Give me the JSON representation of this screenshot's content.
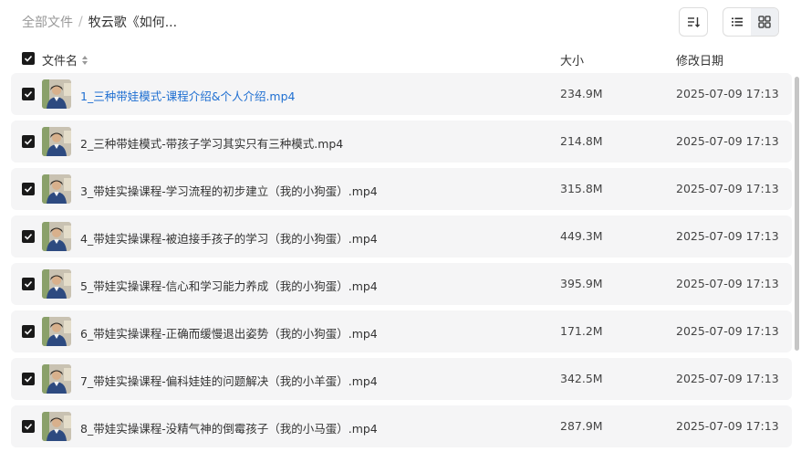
{
  "breadcrumb": {
    "root": "全部文件",
    "separator": "/",
    "current": "牧云歌《如何..."
  },
  "columns": {
    "name": "文件名",
    "size": "大小",
    "modified": "修改日期"
  },
  "files": [
    {
      "name": "1_三种带娃模式-课程介绍&个人介绍.mp4",
      "size": "234.9M",
      "date": "2025-07-09 17:13"
    },
    {
      "name": "2_三种带娃模式-带孩子学习其实只有三种模式.mp4",
      "size": "214.8M",
      "date": "2025-07-09 17:13"
    },
    {
      "name": "3_带娃实操课程-学习流程的初步建立（我的小狗蛋）.mp4",
      "size": "315.8M",
      "date": "2025-07-09 17:13"
    },
    {
      "name": "4_带娃实操课程-被迫接手孩子的学习（我的小狗蛋）.mp4",
      "size": "449.3M",
      "date": "2025-07-09 17:13"
    },
    {
      "name": "5_带娃实操课程-信心和学习能力养成（我的小狗蛋）.mp4",
      "size": "395.9M",
      "date": "2025-07-09 17:13"
    },
    {
      "name": "6_带娃实操课程-正确而缓慢退出姿势（我的小狗蛋）.mp4",
      "size": "171.2M",
      "date": "2025-07-09 17:13"
    },
    {
      "name": "7_带娃实操课程-偏科娃娃的问题解决（我的小羊蛋）.mp4",
      "size": "342.5M",
      "date": "2025-07-09 17:13"
    },
    {
      "name": "8_带娃实操课程-没精气神的倒霉孩子（我的小马蛋）.mp4",
      "size": "287.9M",
      "date": "2025-07-09 17:13"
    }
  ],
  "icons": {
    "sort": "sort-icon",
    "list_view": "list-view-icon",
    "grid_view": "grid-view-icon",
    "thumbnail": "video-thumbnail"
  },
  "colors": {
    "link": "#1f6fd1",
    "row_bg": "#f5f5f6",
    "checkbox": "#1a1a1a"
  }
}
